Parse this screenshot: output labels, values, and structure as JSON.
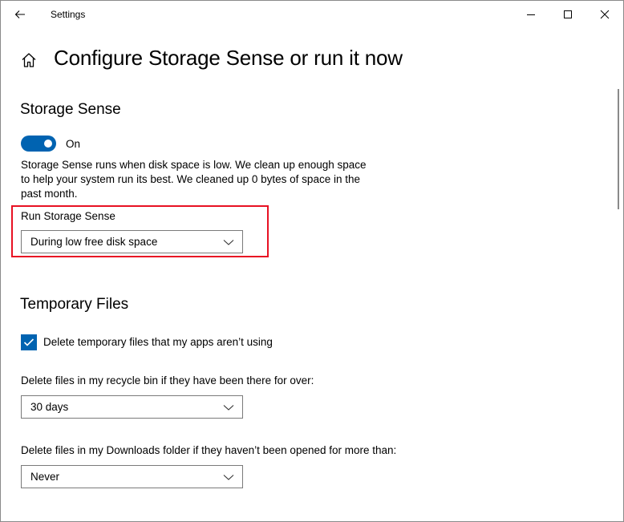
{
  "window": {
    "title": "Settings",
    "back_icon": "back-arrow-icon",
    "controls": [
      "minimize-icon",
      "maximize-icon",
      "close-icon"
    ]
  },
  "page": {
    "title": "Configure Storage Sense or run it now",
    "home_icon": "home-icon"
  },
  "storage_sense": {
    "heading": "Storage Sense",
    "toggle_state": "On",
    "toggle_on": true,
    "description": "Storage Sense runs when disk space is low. We clean up enough space to help your system run its best. We cleaned up 0 bytes of space in the past month.",
    "run_label": "Run Storage Sense",
    "run_value": "During low free disk space"
  },
  "temporary_files": {
    "heading": "Temporary Files",
    "delete_temp_label": "Delete temporary files that my apps aren’t using",
    "delete_temp_checked": true,
    "recycle_label": "Delete files in my recycle bin if they have been there for over:",
    "recycle_value": "30 days",
    "downloads_label": "Delete files in my Downloads folder if they haven’t been opened for more than:",
    "downloads_value": "Never"
  },
  "colors": {
    "accent": "#0063b1",
    "highlight": "#e81123"
  }
}
